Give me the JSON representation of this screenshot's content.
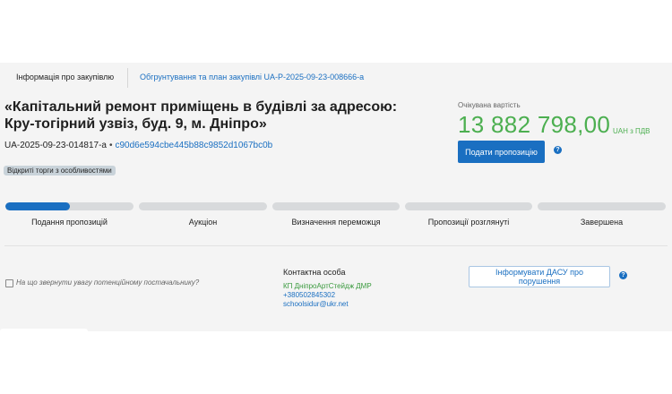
{
  "tabs": {
    "info": "Інформація про закупівлю",
    "plan": "Обгрунтування та план закупівлі UA-P-2025-09-23-008666-a"
  },
  "tender": {
    "title": "«Капітальний ремонт приміщень в будівлі за адресою: Кру-тогірний узвіз, буд. 9, м. Дніпро»",
    "id": "UA-2025-09-23-014817-a",
    "separator": "•",
    "hash": "c90d6e594cbe445b88c9852d1067bc0b",
    "procedure_badge": "Відкриті торги з особливостями"
  },
  "price": {
    "label": "Очікувана вартість",
    "amount": "13 882 798,00",
    "currency_vat": "UAH з ПДВ",
    "color": "#4caf50"
  },
  "actions": {
    "submit_label": "Подати пропозицію",
    "help_glyph": "?",
    "dasu_label": "Інформувати ДАСУ про порушення"
  },
  "stages": {
    "items": [
      {
        "label": "Подання пропозицій",
        "progress": 0.5
      },
      {
        "label": "Аукціон",
        "progress": 0
      },
      {
        "label": "Визначення переможця",
        "progress": 0
      },
      {
        "label": "Пропозиції розглянуті",
        "progress": 0
      },
      {
        "label": "Завершена",
        "progress": 0
      }
    ],
    "active_color": "#1a6fc1",
    "inactive_color": "#d8dadc"
  },
  "hint": {
    "question": "На що звернути увагу потенційному постачальнику?",
    "icon": "edit-icon"
  },
  "contact": {
    "title": "Контактна особа",
    "organization": "КП ДніпроАртСтейдж ДМР",
    "phone": "+380502845302",
    "email": "schoolsidur@ukr.net"
  }
}
